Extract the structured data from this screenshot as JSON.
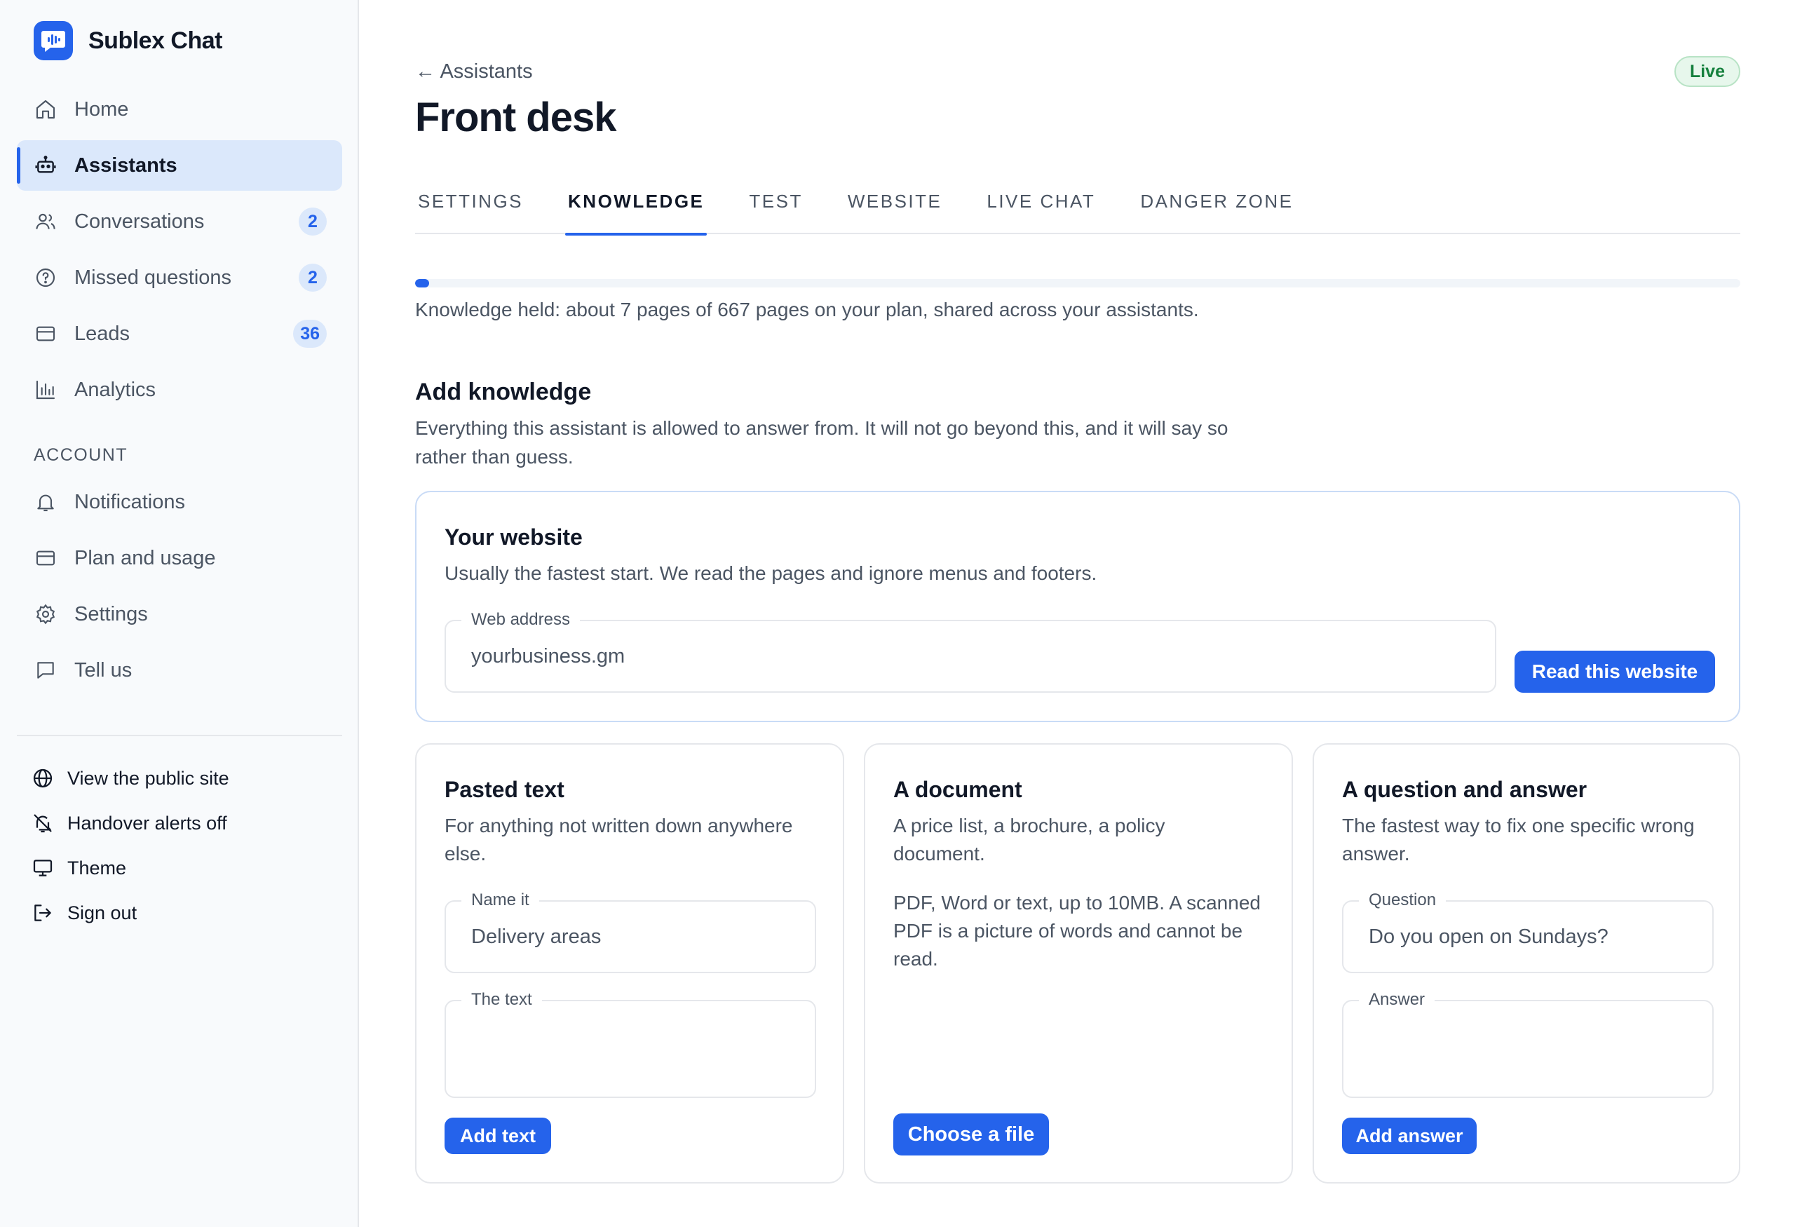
{
  "app": {
    "name": "Sublex Chat"
  },
  "sidebar": {
    "items": [
      {
        "label": "Home",
        "icon": "home-icon"
      },
      {
        "label": "Assistants",
        "icon": "robot-icon",
        "active": true
      },
      {
        "label": "Conversations",
        "icon": "users-icon",
        "badge": "2"
      },
      {
        "label": "Missed questions",
        "icon": "question-circle-icon",
        "badge": "2"
      },
      {
        "label": "Leads",
        "icon": "card-icon",
        "badge": "36"
      },
      {
        "label": "Analytics",
        "icon": "bar-chart-icon"
      }
    ],
    "account_label": "ACCOUNT",
    "account_items": [
      {
        "label": "Notifications",
        "icon": "bell-icon"
      },
      {
        "label": "Plan and usage",
        "icon": "credit-card-icon"
      },
      {
        "label": "Settings",
        "icon": "gear-icon"
      },
      {
        "label": "Tell us",
        "icon": "message-square-icon"
      }
    ],
    "footer": [
      {
        "label": "View the public site",
        "icon": "globe-icon"
      },
      {
        "label": "Handover alerts off",
        "icon": "bell-off-icon"
      },
      {
        "label": "Theme",
        "icon": "monitor-icon"
      },
      {
        "label": "Sign out",
        "icon": "sign-out-icon"
      }
    ]
  },
  "header": {
    "back_label": "← Assistants",
    "title": "Front desk",
    "status": "Live",
    "status_color": "#15803d"
  },
  "tabs": [
    {
      "label": "SETTINGS"
    },
    {
      "label": "KNOWLEDGE",
      "active": true
    },
    {
      "label": "TEST"
    },
    {
      "label": "WEBSITE"
    },
    {
      "label": "LIVE CHAT"
    },
    {
      "label": "DANGER ZONE"
    }
  ],
  "usage": {
    "used_pages": 7,
    "plan_pages": 667,
    "caption": "Knowledge held: about 7 pages of 667 pages on your plan, shared across your assistants."
  },
  "add_knowledge": {
    "title": "Add knowledge",
    "description": "Everything this assistant is allowed to answer from. It will not go beyond this, and it will say so rather than guess."
  },
  "website_card": {
    "title": "Your website",
    "description": "Usually the fastest start. We read the pages and ignore menus and footers.",
    "field_label": "Web address",
    "field_placeholder": "yourbusiness.gm",
    "button": "Read this website"
  },
  "pasted_card": {
    "title": "Pasted text",
    "description": "For anything not written down anywhere else.",
    "name_label": "Name it",
    "name_placeholder": "Delivery areas",
    "text_label": "The text",
    "button": "Add text"
  },
  "document_card": {
    "title": "A document",
    "description": "A price list, a brochure, a policy document.",
    "note": "PDF, Word or text, up to 10MB. A scanned PDF is a picture of words and cannot be read.",
    "button": "Choose a file"
  },
  "qa_card": {
    "title": "A question and answer",
    "description": "The fastest way to fix one specific wrong answer.",
    "question_label": "Question",
    "question_placeholder": "Do you open on Sundays?",
    "answer_label": "Answer",
    "button": "Add answer"
  },
  "colors": {
    "accent": "#2563eb",
    "active_nav_bg": "#dbe8fb",
    "live_bg": "#e7f7ec"
  }
}
